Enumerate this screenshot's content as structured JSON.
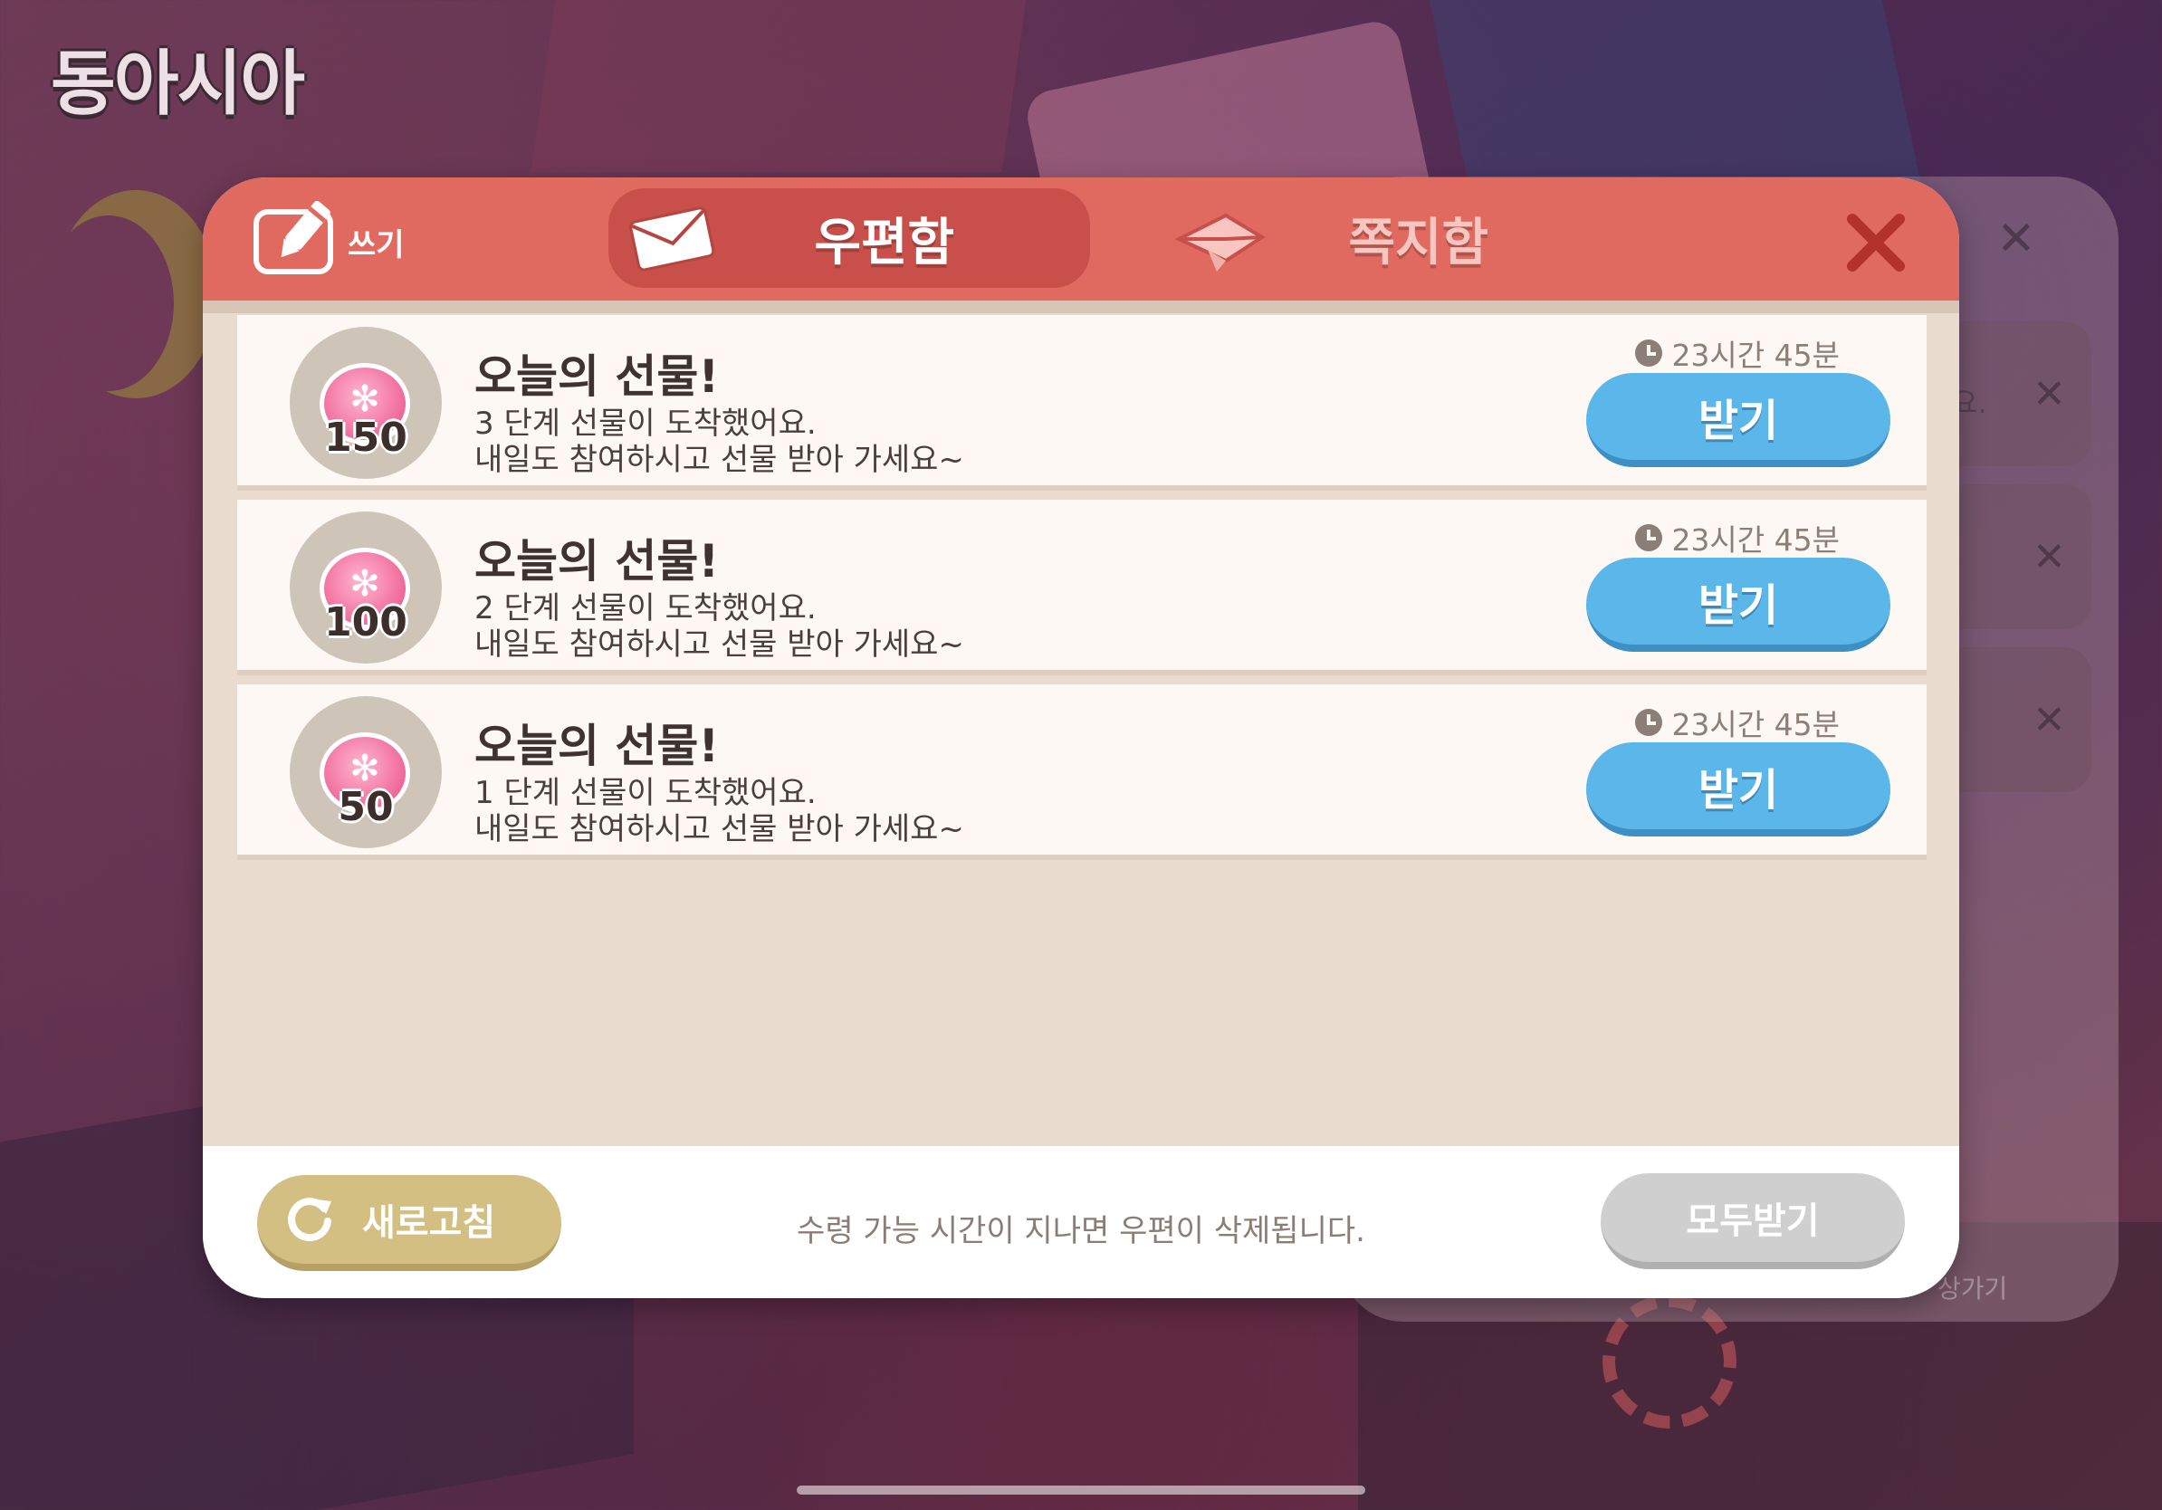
{
  "region_title": "동아시아",
  "header": {
    "write_label": "쓰기",
    "tabs": [
      {
        "label": "우편함",
        "selected": true,
        "icon": "envelope-icon"
      },
      {
        "label": "쪽지함",
        "selected": false,
        "icon": "paper-plane-icon"
      }
    ]
  },
  "mails": [
    {
      "coin_amount": "150",
      "title": "오늘의 선물!",
      "line1": "3 단계 선물이 도착했어요.",
      "line2": "내일도 참여하시고 선물 받아 가세요~",
      "time_left": "23시간 45분",
      "button": "받기"
    },
    {
      "coin_amount": "100",
      "title": "오늘의 선물!",
      "line1": "2 단계 선물이 도착했어요.",
      "line2": "내일도 참여하시고 선물 받아 가세요~",
      "time_left": "23시간 45분",
      "button": "받기"
    },
    {
      "coin_amount": "50",
      "title": "오늘의 선물!",
      "line1": "1 단계 선물이 도착했어요.",
      "line2": "내일도 참여하시고 선물 받아 가세요~",
      "time_left": "23시간 45분",
      "button": "받기"
    }
  ],
  "footer": {
    "refresh_label": "새로고침",
    "note": "수령 가능 시간이 지나면 우편이 삭제됩니다.",
    "receive_all_label": "모두받기"
  },
  "background_panel": {
    "partial_text_1": "요.",
    "partial_text_2": "상가기"
  },
  "colors": {
    "header": "#e06a60",
    "selected_tab": "#c94f4a",
    "receive_button": "#5bb6ea",
    "refresh_button": "#d4bf83",
    "receive_all_button": "#cfcfcf"
  }
}
